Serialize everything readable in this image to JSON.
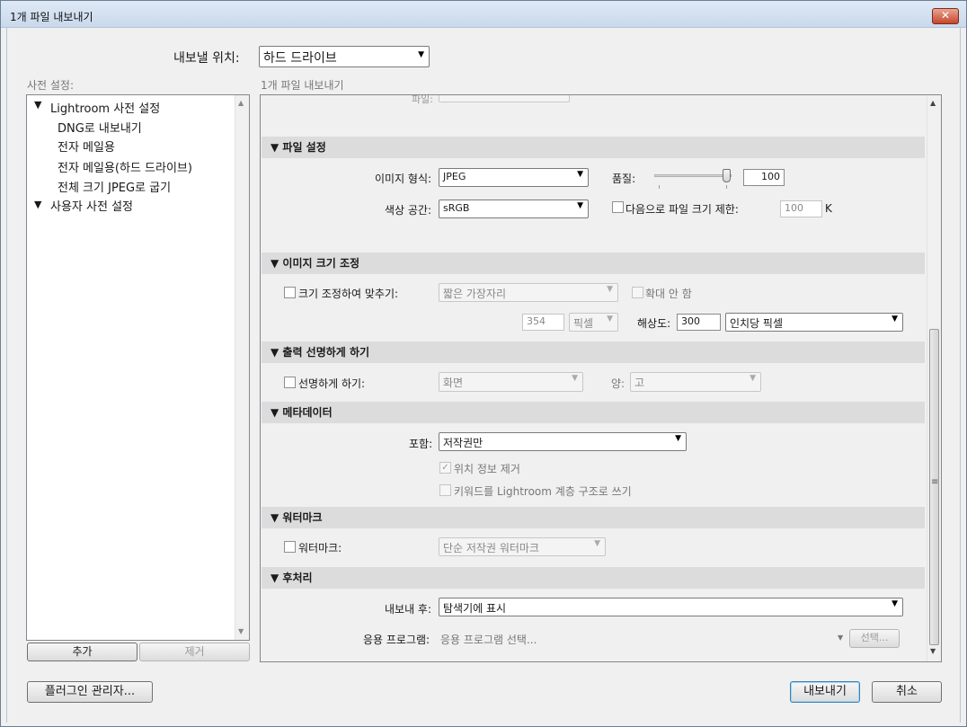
{
  "window": {
    "title": "1개 파일 내보내기",
    "close_glyph": "✕"
  },
  "export_to": {
    "label": "내보낼 위치:",
    "value": "하드 드라이브"
  },
  "presets": {
    "label": "사전 설정:",
    "items": [
      {
        "text": "Lightroom 사전 설정",
        "arrow": "▼"
      },
      {
        "text": "DNG로 내보내기"
      },
      {
        "text": "전자 메일용"
      },
      {
        "text": "전자 메일용(하드 드라이브)"
      },
      {
        "text": "전체 크기 JPEG로 굽기"
      },
      {
        "text": "사용자 사전 설정",
        "arrow": "▼"
      }
    ],
    "add_button": "추가",
    "remove_button": "제거"
  },
  "content_label": "1개 파일 내보내기",
  "cutoff_label": "파일:",
  "file_settings": {
    "header": "▼ 파일 설정",
    "image_format_label": "이미지 형식:",
    "image_format_value": "JPEG",
    "quality_label": "품질:",
    "quality_value": "100",
    "quality_level": 1.0,
    "color_space_label": "색상 공간:",
    "color_space_value": "sRGB",
    "limit_size_label": "다음으로 파일 크기 제한:",
    "limit_size_value": "100",
    "limit_size_unit": "K"
  },
  "image_sizing": {
    "header": "▼ 이미지 크기 조정",
    "resize_label": "크기 조정하여 맞추기:",
    "resize_value": "짧은 가장자리",
    "dont_enlarge_label": "확대 안 함",
    "size_value": "354",
    "unit_value": "픽셀",
    "resolution_label": "해상도:",
    "resolution_value": "300",
    "resolution_unit": "인치당 픽셀"
  },
  "output_sharpening": {
    "header": "▼ 출력 선명하게 하기",
    "sharpen_label": "선명하게 하기:",
    "sharpen_for": "화면",
    "amount_label": "양:",
    "amount_value": "고"
  },
  "metadata": {
    "header": "▼ 메타데이터",
    "include_label": "포함:",
    "include_value": "저작권만",
    "remove_location_label": "위치 정보 제거",
    "remove_location_check": "✓",
    "keywords_label": "키워드를 Lightroom 계층 구조로 쓰기"
  },
  "watermarking": {
    "header": "▼ 워터마크",
    "watermark_label": "워터마크:",
    "watermark_value": "단순 저작권 워터마크"
  },
  "post_processing": {
    "header": "▼ 후처리",
    "after_export_label": "내보내 후:",
    "after_export_value": "탐색기에 표시",
    "application_label": "응용 프로그램:",
    "application_placeholder": "응용 프로그램 선택...",
    "choose_button": "선택..."
  },
  "footer": {
    "plugin_manager": "플러그인 관리자...",
    "export_button": "내보내기",
    "cancel_button": "취소"
  },
  "icons": {
    "dropdown": "▼",
    "scroll_up": "▲",
    "scroll_down": "▼",
    "grip": "≡"
  },
  "colors": {
    "title_bar": "#c9d9ec",
    "close_button": "#c7462a",
    "section_header": "#dcdcdc",
    "default_button_border": "#3c7fb1"
  }
}
